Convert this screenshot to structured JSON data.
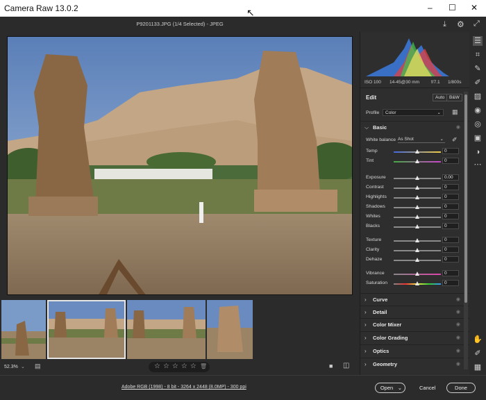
{
  "app": {
    "title": "Camera Raw 13.0.2"
  },
  "file_header": "P9201133.JPG (1/4 Selected)  -  JPEG",
  "histogram": {
    "iso": "ISO 100",
    "lens": "14-45@30 mm",
    "aperture": "f/7.1",
    "shutter": "1/800s"
  },
  "edit": {
    "title": "Edit",
    "auto": "Auto",
    "bw": "B&W",
    "profile_label": "Profile",
    "profile_value": "Color"
  },
  "basic": {
    "title": "Basic",
    "wb_label": "White balance",
    "wb_value": "As Shot",
    "sliders": [
      {
        "label": "Temp",
        "value": "0"
      },
      {
        "label": "Tint",
        "value": "0"
      },
      {
        "label": "Exposure",
        "value": "0.00"
      },
      {
        "label": "Contrast",
        "value": "0"
      },
      {
        "label": "Highlights",
        "value": "0"
      },
      {
        "label": "Shadows",
        "value": "0"
      },
      {
        "label": "Whites",
        "value": "0"
      },
      {
        "label": "Blacks",
        "value": "0"
      },
      {
        "label": "Texture",
        "value": "0"
      },
      {
        "label": "Clarity",
        "value": "0"
      },
      {
        "label": "Dehaze",
        "value": "0"
      },
      {
        "label": "Vibrance",
        "value": "0"
      },
      {
        "label": "Saturation",
        "value": "0"
      }
    ]
  },
  "sections": [
    "Curve",
    "Detail",
    "Color Mixer",
    "Color Grading",
    "Optics",
    "Geometry"
  ],
  "zoom": "52.3%",
  "footer": {
    "info": "Adobe RGB (1998) - 8 bit - 3264 x 2448 (8.0MP) - 300 ppi",
    "open": "Open",
    "cancel": "Cancel",
    "done": "Done"
  },
  "colors": {
    "accent": "#1473e6",
    "panel": "#2e2e2e",
    "bg": "#2b2b2b"
  }
}
